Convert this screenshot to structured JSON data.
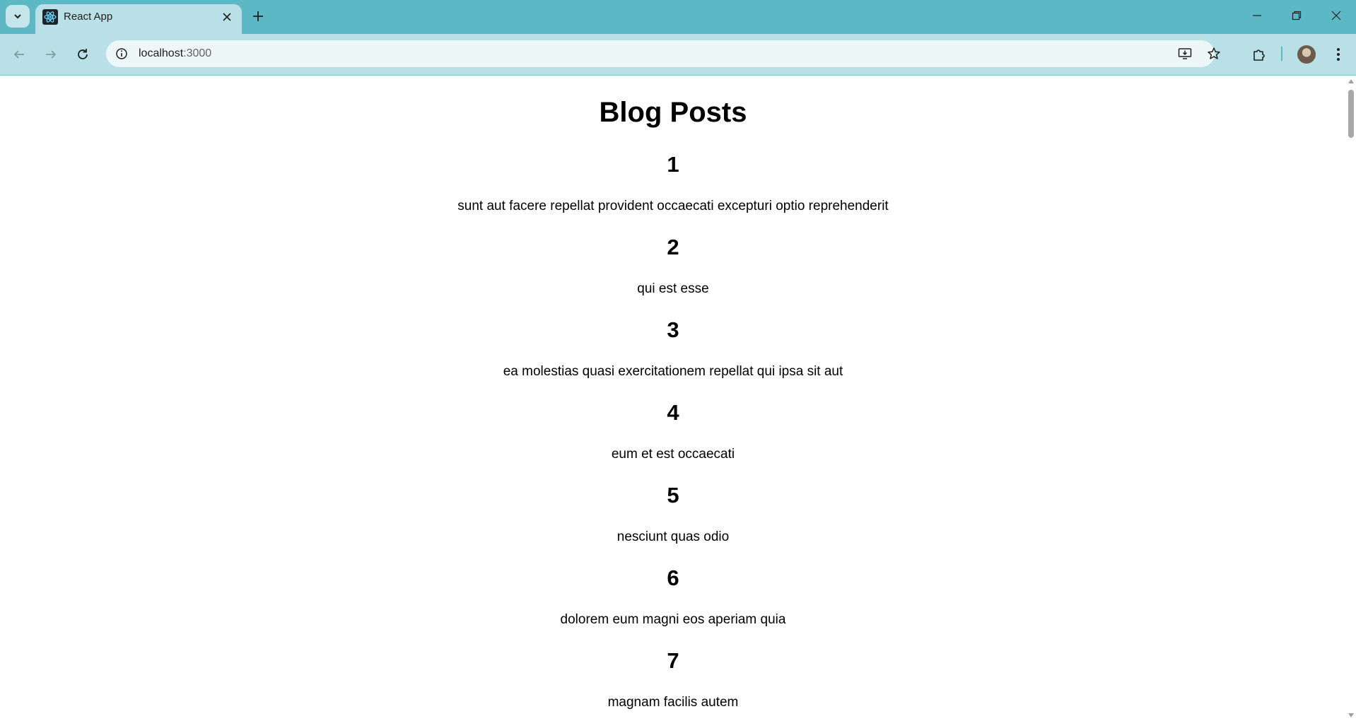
{
  "browser": {
    "tab": {
      "title": "React App"
    },
    "address": {
      "host": "localhost",
      "port": ":3000"
    }
  },
  "page": {
    "title": "Blog Posts",
    "posts": [
      {
        "id": "1",
        "title": "sunt aut facere repellat provident occaecati excepturi optio reprehenderit"
      },
      {
        "id": "2",
        "title": "qui est esse"
      },
      {
        "id": "3",
        "title": "ea molestias quasi exercitationem repellat qui ipsa sit aut"
      },
      {
        "id": "4",
        "title": "eum et est occaecati"
      },
      {
        "id": "5",
        "title": "nesciunt quas odio"
      },
      {
        "id": "6",
        "title": "dolorem eum magni eos aperiam quia"
      },
      {
        "id": "7",
        "title": "magnam facilis autem"
      }
    ]
  },
  "colors": {
    "titlebar": "#5bb8c4",
    "toolbar": "#b9e0e6",
    "omnibox": "#eef7f8"
  }
}
